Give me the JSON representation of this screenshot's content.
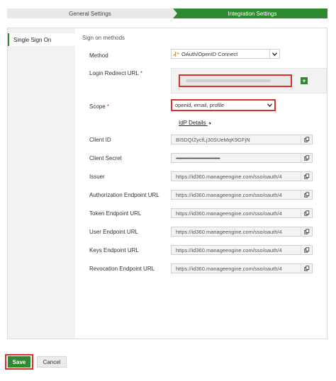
{
  "wizard": {
    "step1": "General Settings",
    "step2": "Integration Settings"
  },
  "sidebar": {
    "items": [
      {
        "label": "Single Sign On"
      }
    ]
  },
  "form": {
    "section_title": "Sign on methods",
    "method_label": "Method",
    "method_value": "OAuth/OpenID Connect",
    "redirect_label": "Login Redirect URL",
    "required_mark": "*",
    "add_label": "+",
    "scope_label": "Scope",
    "scope_value": "openid, email, profile",
    "idp_details": "IdP Details",
    "idp_caret": "▾",
    "rows": [
      {
        "label": "Client ID",
        "value": "BI5DQIZycfLj30SUeMqK9GFjN"
      },
      {
        "label": "Client Secret",
        "value": "••••••••••••••••••••••••••••••••••••••"
      },
      {
        "label": "Issuer",
        "value": "https://id360.manageengine.com/sso/oauth/4"
      },
      {
        "label": "Authorization Endpoint URL",
        "value": "https://id360.manageengine.com/sso/oauth/4"
      },
      {
        "label": "Token Endpoint URL",
        "value": "https://id360.manageengine.com/sso/oauth/4"
      },
      {
        "label": "User Endpoint URL",
        "value": "https://id360.manageengine.com/sso/oauth/4"
      },
      {
        "label": "Keys Endpoint URL",
        "value": "https://id360.manageengine.com/sso/oauth/4"
      },
      {
        "label": "Revocation Endpoint URL",
        "value": "https://id360.manageengine.com/sso/oauth/4"
      }
    ]
  },
  "footer": {
    "save_label": "Save",
    "cancel_label": "Cancel"
  },
  "colors": {
    "accent": "#2f8a2f",
    "highlight": "#d9302a"
  }
}
